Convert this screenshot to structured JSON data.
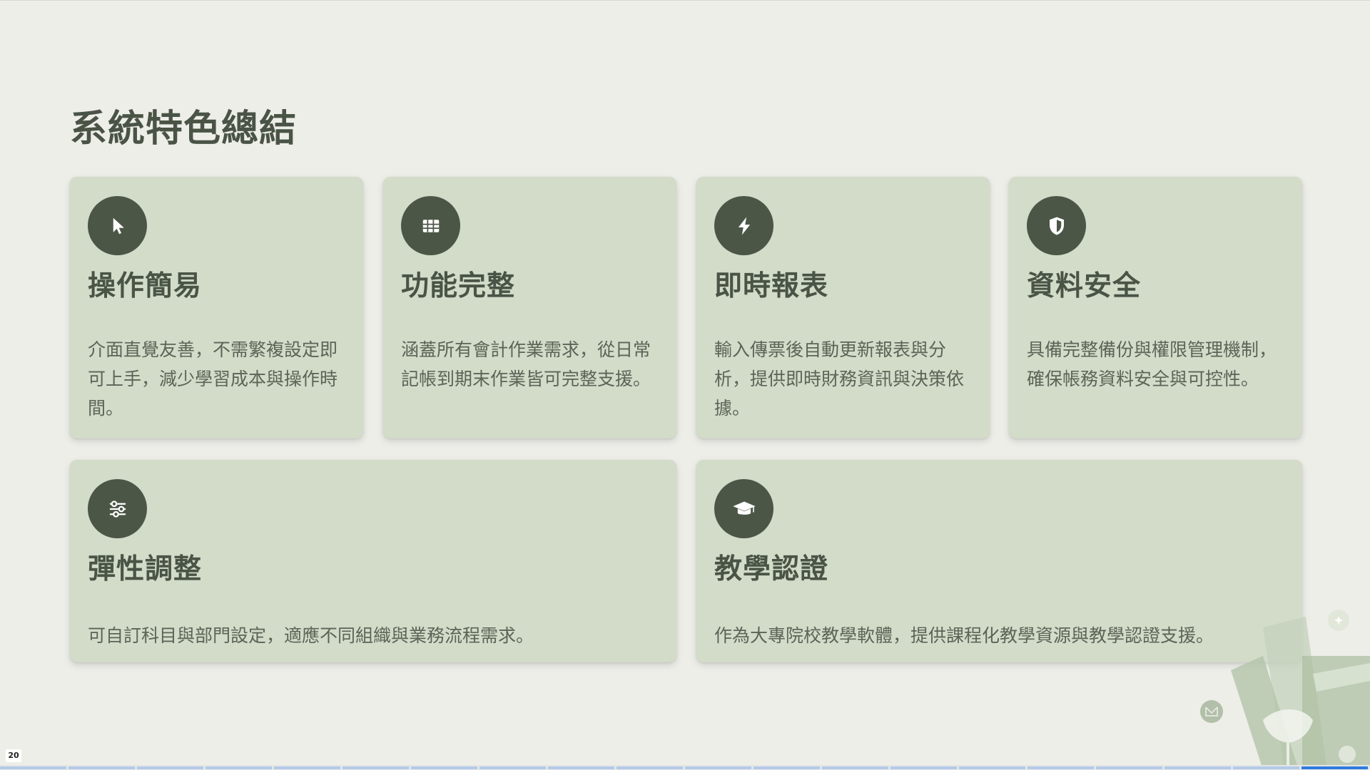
{
  "page": {
    "title": "系統特色總結",
    "slide_number": "20"
  },
  "cards": [
    {
      "icon": "cursor-icon",
      "title": "操作簡易",
      "desc": "介面直覺友善，不需繁複設定即可上手，減少學習成本與操作時間。"
    },
    {
      "icon": "table-icon",
      "title": "功能完整",
      "desc": "涵蓋所有會計作業需求，從日常記帳到期末作業皆可完整支援。"
    },
    {
      "icon": "bolt-icon",
      "title": "即時報表",
      "desc": "輸入傳票後自動更新報表與分析，提供即時財務資訊與決策依據。"
    },
    {
      "icon": "shield-icon",
      "title": "資料安全",
      "desc": "具備完整備份與權限管理機制，確保帳務資料安全與可控性。"
    },
    {
      "icon": "sliders-icon",
      "title": "彈性調整",
      "desc": "可自訂科目與部門設定，適應不同組織與業務流程需求。"
    },
    {
      "icon": "graduation-cap-icon",
      "title": "教學認證",
      "desc": "作為大專院校教學軟體，提供課程化教學資源與教學認證支援。"
    }
  ],
  "colors": {
    "background": "#eeeee9",
    "card": "#d3dbc9",
    "icon_circle": "#4b5647",
    "text": "#4a5446",
    "progress_active": "#2f7be0",
    "progress_inactive": "#b3c9e8"
  },
  "progress": {
    "total_slides": 20,
    "current_slide": 20
  }
}
